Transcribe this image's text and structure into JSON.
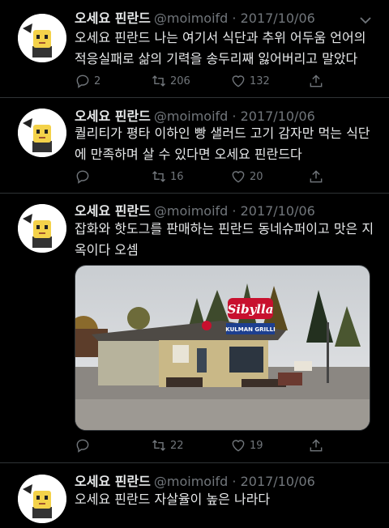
{
  "account": {
    "name": "오세요 핀란드",
    "handle_and_date": "@moimoifd · 2017/10/06"
  },
  "tweets": [
    {
      "text": "오세요 핀란드 나는 여기서 식단과 추위 어두움 언어의 적응실패로 삶의 기력을 송두리째 잃어버리고 말았다",
      "replies": "2",
      "retweets": "206",
      "likes": "132"
    },
    {
      "text": "퀄리티가 평타 이하인 빵 샐러드 고기 감자만 먹는 식단에 만족하며 살 수 있다면 오세요 핀란드다",
      "replies": "",
      "retweets": "16",
      "likes": "20"
    },
    {
      "text": "잡화와 핫도그를 판매하는 핀란드 동네슈퍼이고 맛은 지옥이다 오셈",
      "replies": "",
      "retweets": "22",
      "likes": "19",
      "photo": {
        "sign_main": "Sibylla",
        "sign_sub": "KULMAN GRILLI"
      }
    },
    {
      "text": "오세요 핀란드 자살율이 높은 나라다"
    }
  ],
  "colors": {
    "background": "#000000",
    "text": "#e7e9ea",
    "muted": "#71767b",
    "divider": "#2f3336",
    "sign_red": "#c8102e",
    "sign_blue": "#1d3f8f"
  },
  "icons": [
    "reply-icon",
    "retweet-icon",
    "like-icon",
    "share-icon",
    "chevron-down-icon",
    "avatar-icon"
  ]
}
